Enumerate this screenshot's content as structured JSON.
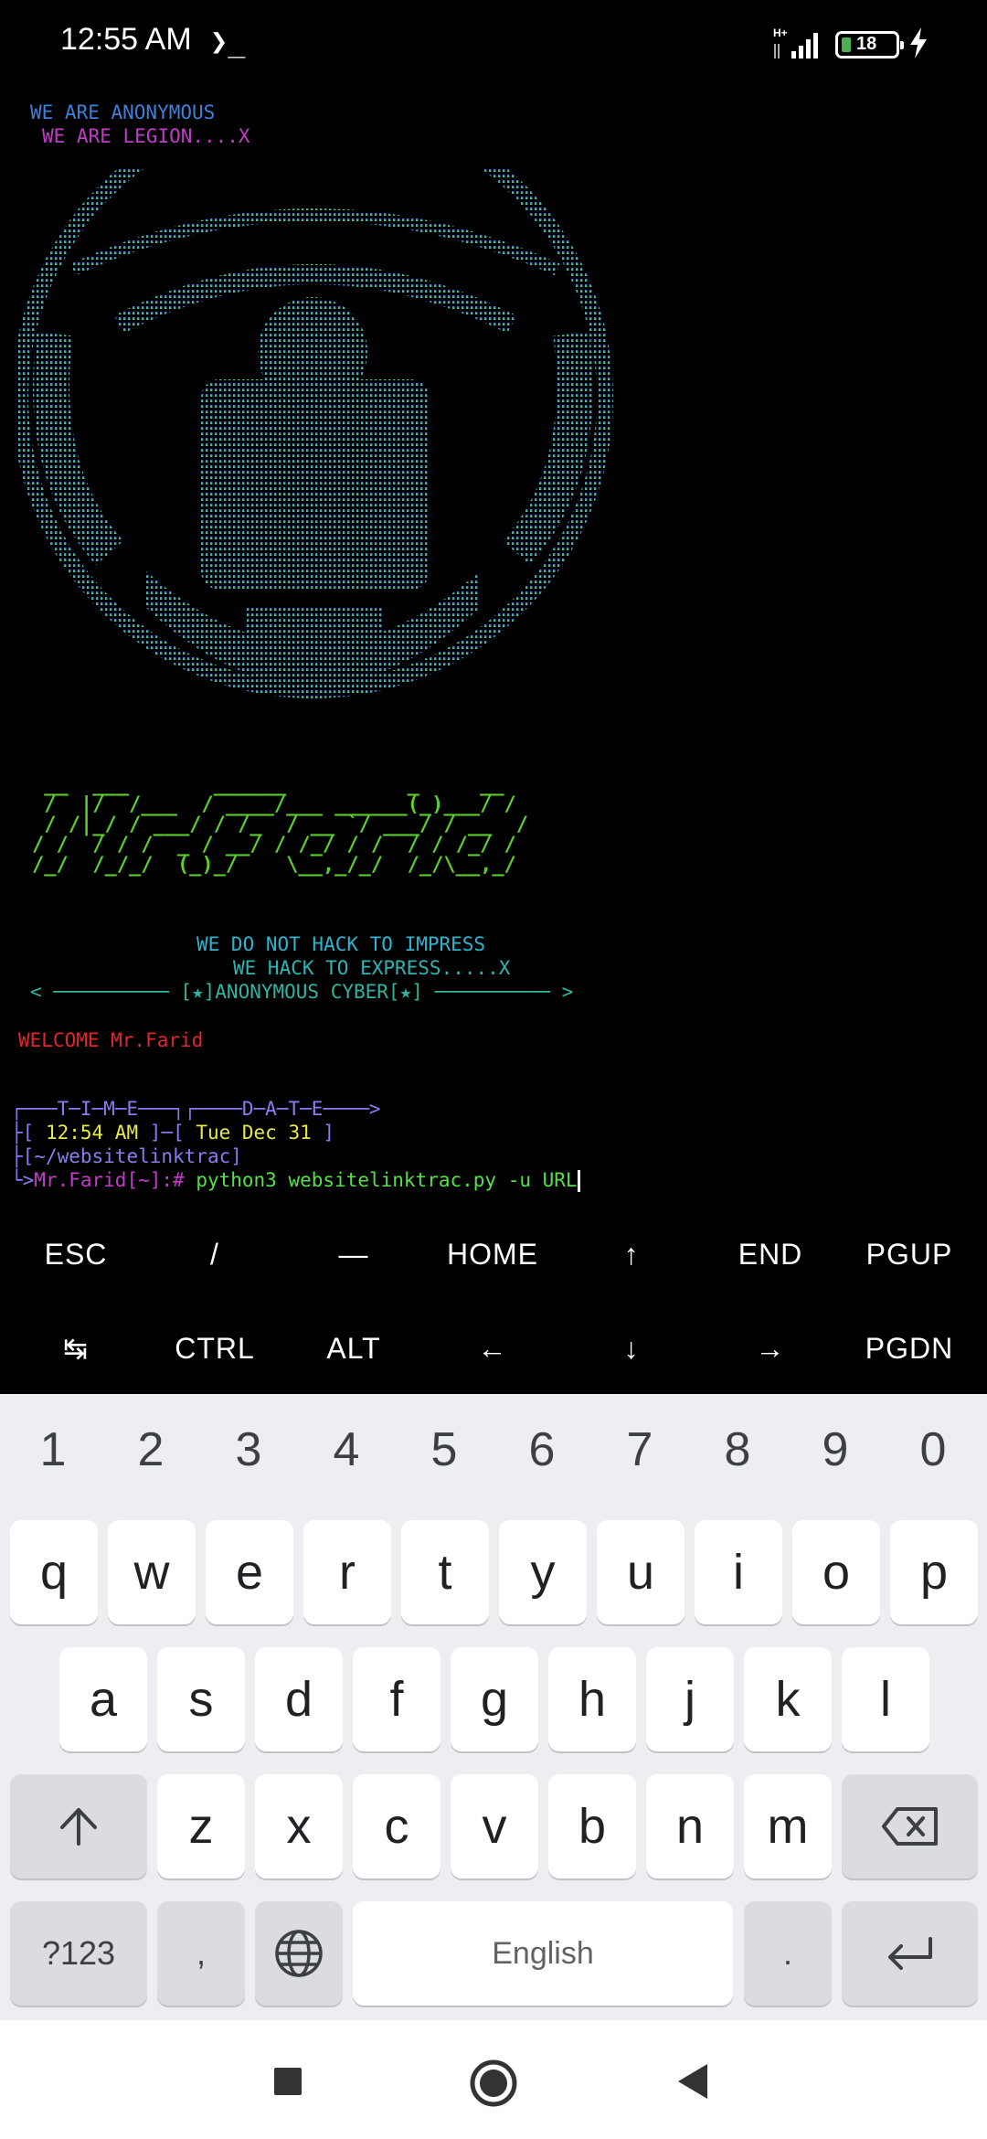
{
  "status_bar": {
    "time": "12:55 AM",
    "terminal_icon": "❯_",
    "network": "H+",
    "battery": "18",
    "charging_icon": "bolt-icon"
  },
  "terminal": {
    "banner": [
      "WE ARE ANONYMOUS",
      "WE ARE LEGION....X"
    ],
    "logo_art": [
      " __  ___       ______          _     __",
      " /  |/  /___  / ____/___ ______(_)___/ /",
      " / /|_/ / ___/ / /_  / __ `/ ___/ / __  / ",
      "/ /  / / /  _ / __/ / /_/ / /  / / /_/ /  ",
      "/_/  /_/_/  (_)_/    \\__,_/_/  /_/\\__,_/   "
    ],
    "motto": [
      "WE DO NOT HACK TO IMPRESS",
      "WE HACK TO EXPRESS.....X"
    ],
    "divider": "< ────────── [★]ANONYMOUS CYBER[★] ────────── >",
    "welcome": "WELCOME Mr.Farid",
    "time_date_header": "┌───T─I─M─E───┐┌────D─A─T─E────>",
    "time_value": "12:54 AM",
    "date_value": "Tue Dec 31",
    "cwd": "~/websitelinktrac",
    "prompt_user": "Mr.Farid[~]:#",
    "command": "python3 websitelinktrac.py -u URL"
  },
  "extra_keys": {
    "row1": [
      "ESC",
      "/",
      "—",
      "HOME",
      "↑",
      "END",
      "PGUP"
    ],
    "row2": [
      "↹",
      "CTRL",
      "ALT",
      "←",
      "↓",
      "→",
      "PGDN"
    ]
  },
  "keyboard": {
    "numbers": [
      "1",
      "2",
      "3",
      "4",
      "5",
      "6",
      "7",
      "8",
      "9",
      "0"
    ],
    "row1": [
      "q",
      "w",
      "e",
      "r",
      "t",
      "y",
      "u",
      "i",
      "o",
      "p"
    ],
    "row2": [
      "a",
      "s",
      "d",
      "f",
      "g",
      "h",
      "j",
      "k",
      "l"
    ],
    "row3": [
      "z",
      "x",
      "c",
      "v",
      "b",
      "n",
      "m"
    ],
    "symbols_label": "?123",
    "comma": ",",
    "space_label": "English",
    "period": "."
  },
  "colors": {
    "blue": "#4a7bd9",
    "magenta": "#c03cc8",
    "green": "#55e04a",
    "teal": "#2fb4b4",
    "red": "#e0262c",
    "yellow": "#e8e84a",
    "lilac": "#8a7cf0"
  }
}
